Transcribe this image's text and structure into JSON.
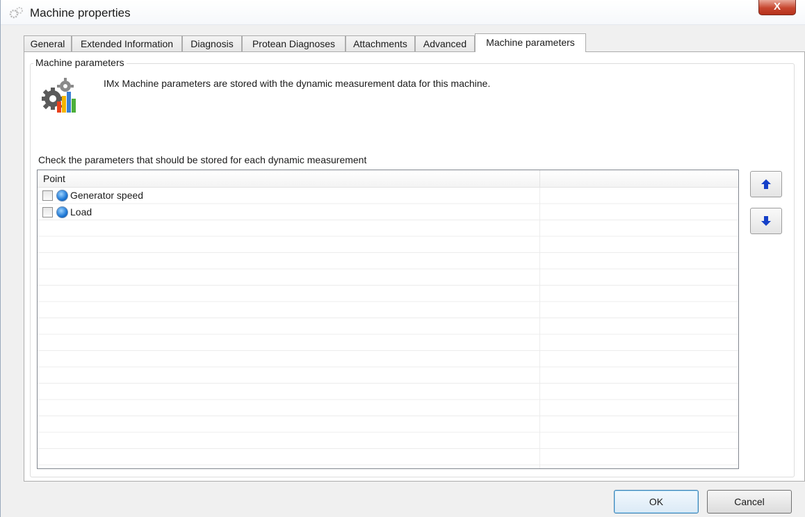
{
  "window": {
    "title": "Machine properties",
    "close_label": "X"
  },
  "tabs": [
    {
      "label": "General",
      "active": false
    },
    {
      "label": "Extended Information",
      "active": false
    },
    {
      "label": "Diagnosis",
      "active": false
    },
    {
      "label": "Protean Diagnoses",
      "active": false
    },
    {
      "label": "Attachments",
      "active": false
    },
    {
      "label": "Advanced",
      "active": false
    },
    {
      "label": "Machine parameters",
      "active": true
    }
  ],
  "group": {
    "legend": "Machine parameters",
    "description": "IMx Machine parameters are stored with the dynamic measurement data for this machine.",
    "icon": "gears-chart-icon"
  },
  "list": {
    "instruction": "Check the parameters that should be stored for each dynamic measurement",
    "columns": [
      "Point",
      ""
    ],
    "rows": [
      {
        "label": "Generator speed",
        "checked": false,
        "icon": "blue-point-icon"
      },
      {
        "label": "Load",
        "checked": false,
        "icon": "blue-point-icon"
      }
    ]
  },
  "side_buttons": {
    "up_icon": "arrow-up-icon",
    "down_icon": "arrow-down-icon"
  },
  "buttons": {
    "ok": "OK",
    "cancel": "Cancel"
  },
  "colors": {
    "arrow": "#1540c8",
    "close": "#c7462f",
    "point": "#1d78d6"
  }
}
